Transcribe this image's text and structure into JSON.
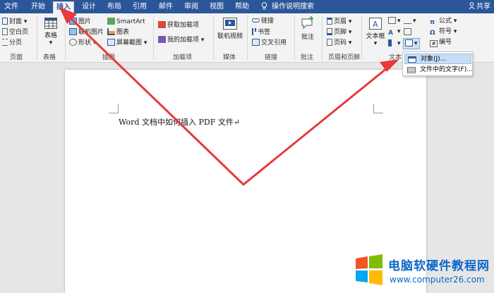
{
  "tabs": [
    "文件",
    "开始",
    "插入",
    "设计",
    "布局",
    "引用",
    "邮件",
    "审阅",
    "视图",
    "帮助"
  ],
  "active_tab": "插入",
  "tell_me": "操作说明搜索",
  "share": "共享",
  "ribbon": {
    "pages": {
      "cover": "封面",
      "blank": "空白页",
      "break": "分页",
      "label": "页面"
    },
    "tables": {
      "table": "表格",
      "label": "表格"
    },
    "illustrations": {
      "picture": "图片",
      "online_picture": "联机图片",
      "shapes": "形状",
      "smartart": "SmartArt",
      "chart": "图表",
      "screenshot": "屏幕截图",
      "label": "插图"
    },
    "addins": {
      "get": "获取加载项",
      "my": "我的加载项",
      "label": "加载项"
    },
    "media": {
      "video": "联机视频",
      "label": "媒体"
    },
    "links": {
      "link": "链接",
      "bookmark": "书签",
      "crossref": "交叉引用",
      "label": "链接"
    },
    "comments": {
      "comment": "批注",
      "label": "批注"
    },
    "header_footer": {
      "header": "页眉",
      "footer": "页脚",
      "page_number": "页码",
      "label": "页眉和页脚"
    },
    "text": {
      "textbox": "文本框",
      "label": "文本"
    },
    "symbols": {
      "equation": "公式",
      "symbol": "符号",
      "number": "编号"
    }
  },
  "dropdown": {
    "object": "对象(J)...",
    "text_from_file": "文件中的文字(F)..."
  },
  "document": {
    "text": "Word 文档中如何插入 PDF 文件↵"
  },
  "watermark": {
    "title": "电脑软硬件教程网",
    "url": "www.computer26.com"
  },
  "colors": {
    "tab_bar": "#2b579a",
    "arrow": "#e8393b",
    "watermark": "#0a69c9"
  }
}
